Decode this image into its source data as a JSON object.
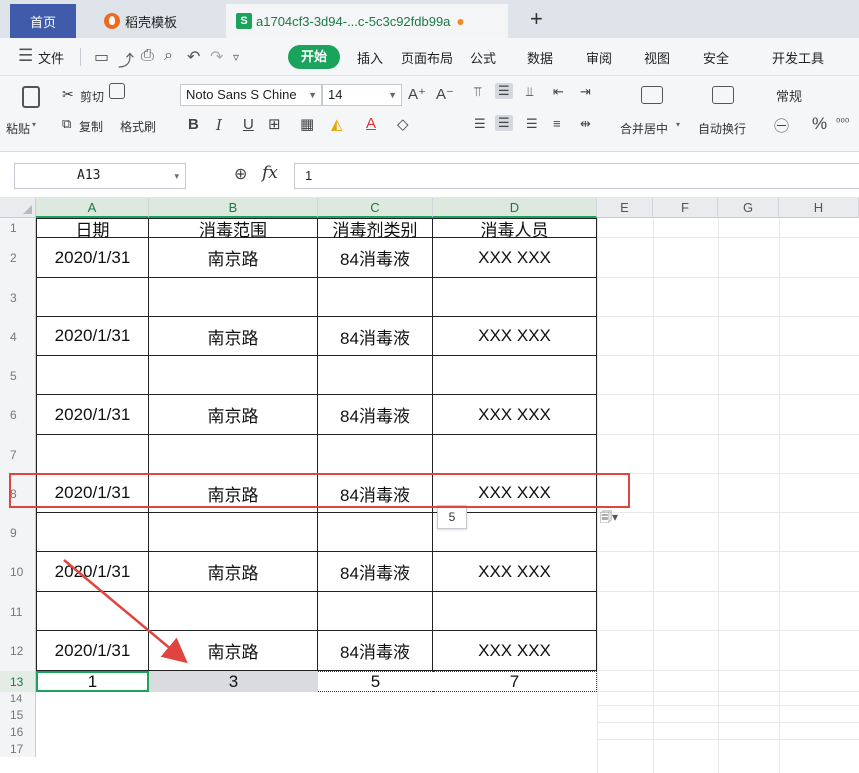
{
  "tabs": {
    "home": "首页",
    "template": "稻壳模板",
    "file_icon": "S",
    "file": "a1704cf3-3d94-...c-5c3c92fdb99a",
    "modified_dot": "●",
    "add": "+"
  },
  "menu": {
    "file": "文件",
    "items": [
      "开始",
      "插入",
      "页面布局",
      "公式",
      "数据",
      "审阅",
      "视图",
      "安全",
      "开发工具"
    ],
    "colors": {
      "start_bg": "#1aa35c",
      "home_tab": "#3f5ba9"
    }
  },
  "ribbon": {
    "paste": "粘贴",
    "cut": "剪切",
    "copy": "复制",
    "format_painter": "格式刷",
    "font_name": "Noto Sans S Chine",
    "font_size": "14",
    "merge_center": "合并居中",
    "wrap_text": "自动换行",
    "number_format": "常规"
  },
  "formula_bar": {
    "name_box": "A13",
    "fx": "fx",
    "value": "1"
  },
  "columns": [
    "A",
    "B",
    "C",
    "D",
    "E",
    "F",
    "G",
    "H"
  ],
  "rows": [
    "1",
    "2",
    "3",
    "4",
    "5",
    "6",
    "7",
    "8",
    "9",
    "10",
    "11",
    "12",
    "13",
    "14",
    "15",
    "16",
    "17"
  ],
  "sheet": {
    "header": [
      "日期",
      "消毒范围",
      "消毒剂类别",
      "消毒人员"
    ],
    "data_rows": [
      [
        "2020/1/31",
        "南京路",
        "84消毒液",
        "XXX XXX"
      ],
      [
        "",
        "",
        "",
        ""
      ],
      [
        "2020/1/31",
        "南京路",
        "84消毒液",
        "XXX XXX"
      ],
      [
        "",
        "",
        "",
        ""
      ],
      [
        "2020/1/31",
        "南京路",
        "84消毒液",
        "XXX XXX"
      ],
      [
        "",
        "",
        "",
        ""
      ],
      [
        "2020/1/31",
        "南京路",
        "84消毒液",
        "XXX XXX"
      ],
      [
        "",
        "",
        "",
        ""
      ],
      [
        "2020/1/31",
        "南京路",
        "84消毒液",
        "XXX XXX"
      ],
      [
        "",
        "",
        "",
        ""
      ],
      [
        "2020/1/31",
        "南京路",
        "84消毒液",
        "XXX XXX"
      ]
    ],
    "row13": [
      "1",
      "3",
      "5",
      "7"
    ]
  },
  "paste_tooltip": "5",
  "smart_tag_icon": "clipboard-icon"
}
